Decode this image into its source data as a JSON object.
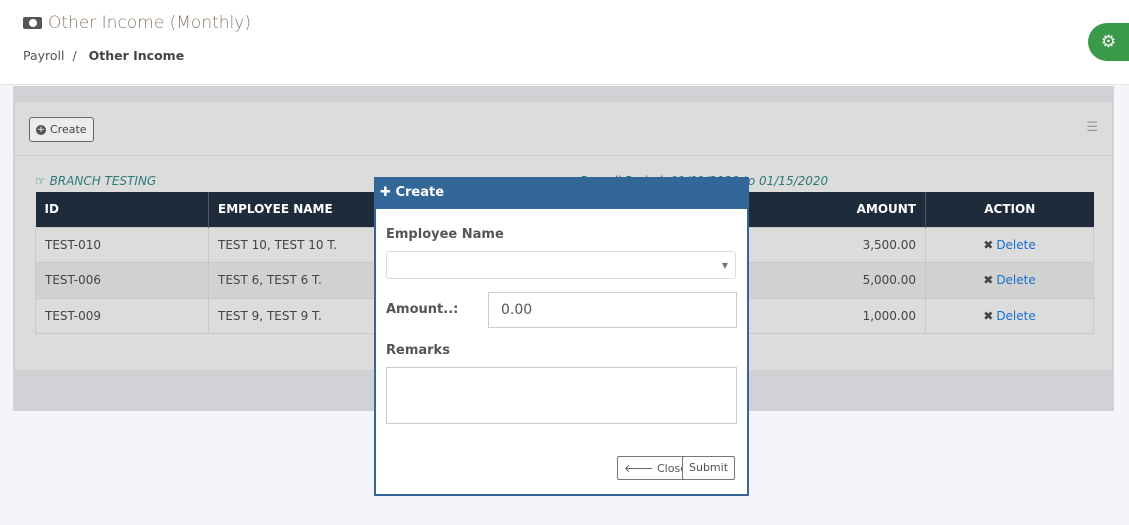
{
  "header": {
    "title": "Other Income (Monthly)",
    "breadcrumb": [
      "Payroll",
      "Other Income"
    ]
  },
  "toolbar": {
    "create_label": "Create"
  },
  "branch": "BRANCH TESTING",
  "period": "Payroll Period: 01/01/2020 to 01/15/2020",
  "table": {
    "headers": [
      "ID",
      "EMPLOYEE NAME",
      "",
      "AMOUNT",
      "ACTION"
    ],
    "rows": [
      {
        "id": "TEST-010",
        "name": "TEST 10, TEST 10 T.",
        "amount": "3,500.00",
        "action": "Delete"
      },
      {
        "id": "TEST-006",
        "name": "TEST 6, TEST 6 T.",
        "amount": "5,000.00",
        "action": "Delete"
      },
      {
        "id": "TEST-009",
        "name": "TEST 9, TEST 9 T.",
        "amount": "1,000.00",
        "action": "Delete"
      }
    ]
  },
  "modal": {
    "title": "Create",
    "employee_label": "Employee Name",
    "employee_value": "",
    "amount_label": "Amount..:",
    "amount_value": "0.00",
    "remarks_label": "Remarks",
    "remarks_value": "",
    "close_label": "Close",
    "submit_label": "Submit"
  }
}
